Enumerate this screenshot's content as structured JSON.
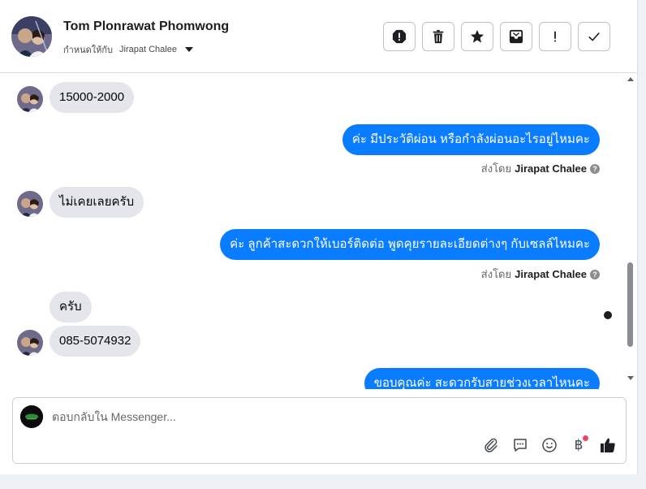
{
  "header": {
    "contact_name": "Tom Plonrawat Phomwong",
    "assign_prefix": "กำหนดให้กับ",
    "assignee": "Jirapat Chalee",
    "toolbar": [
      "spam-icon",
      "trash-icon",
      "star-icon",
      "archive-icon",
      "alert-icon",
      "check-icon"
    ]
  },
  "thread": {
    "messages": [
      {
        "direction": "in",
        "text": "15000-2000"
      },
      {
        "direction": "out",
        "text": "ค่ะ มีประวัติผ่อน หรือกำลังผ่อนอะไรอยู่ไหมคะ"
      },
      {
        "direction": "in",
        "text": "ไม่เคยเลยครับ"
      },
      {
        "direction": "out",
        "text": "ค่ะ ลูกค้าสะดวกให้เบอร์ติดต่อ พูดคุยรายละเอียดต่างๆ กับเซลล์ไหมคะ"
      },
      {
        "direction": "in",
        "text": "ครับ"
      },
      {
        "direction": "in",
        "text": "085-5074932"
      },
      {
        "direction": "out",
        "text": "ขอบคุณค่ะ สะดวกรับสายช่วงเวลาไหนคะ"
      }
    ],
    "sent_by_prefix": "ส่งโดย",
    "sent_by_name": "Jirapat Chalee"
  },
  "composer": {
    "placeholder": "ตอบกลับใน Messenger...",
    "value": "",
    "tools": [
      "paperclip-icon",
      "chat-bubble-icon",
      "emoji-icon",
      "baht-icon",
      "thumbs-up-icon"
    ],
    "baht_symbol": "฿"
  },
  "colors": {
    "outgoing_bubble": "#0a7cff",
    "incoming_bubble": "#e4e6eb",
    "notification_dot": "#f3425f"
  }
}
